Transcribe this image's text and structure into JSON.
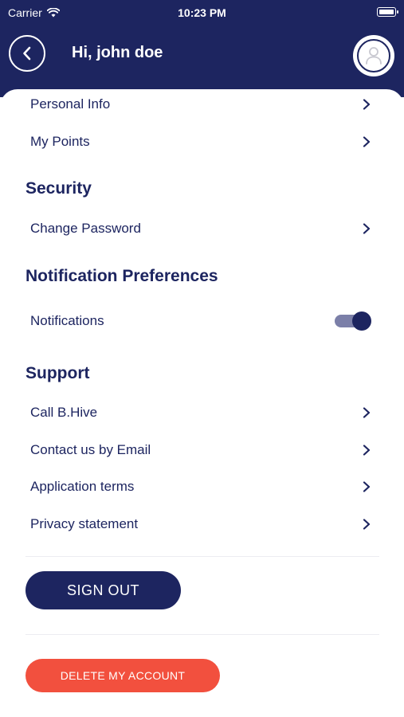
{
  "status_bar": {
    "carrier": "Carrier",
    "time": "10:23 PM"
  },
  "header": {
    "title": "Hi, john doe"
  },
  "account": {
    "items": [
      {
        "label": "Personal Info"
      },
      {
        "label": "My Points"
      }
    ]
  },
  "security": {
    "heading": "Security",
    "items": [
      {
        "label": "Change Password"
      }
    ]
  },
  "notification_preferences": {
    "heading": "Notification Preferences",
    "notifications_label": "Notifications",
    "notifications_enabled": true
  },
  "support": {
    "heading": "Support",
    "items": [
      {
        "label": "Call B.Hive"
      },
      {
        "label": "Contact us by Email"
      },
      {
        "label": "Application terms"
      },
      {
        "label": "Privacy statement"
      }
    ]
  },
  "actions": {
    "sign_out_label": "SIGN OUT",
    "delete_account_label": "DELETE MY ACCOUNT"
  },
  "colors": {
    "primary": "#1d2560",
    "danger": "#f2503e"
  },
  "icons": {
    "back": "chevron-left-icon",
    "avatar": "user-icon",
    "row": "chevron-right-icon",
    "wifi": "wifi-icon",
    "battery": "battery-icon"
  }
}
